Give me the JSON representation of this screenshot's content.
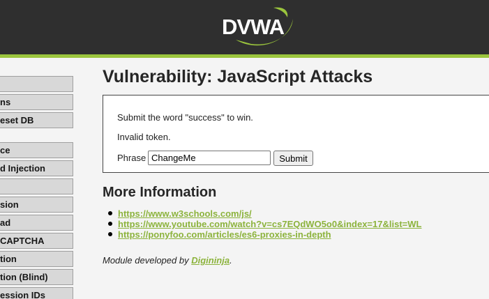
{
  "logo": {
    "text": "DVWA",
    "swoosh_color": "#9bc53d"
  },
  "colors": {
    "header_bg": "#2f2f2f",
    "accent": "#9bc53d",
    "link": "#8cb33c"
  },
  "sidebar": {
    "items": [
      {
        "label": ""
      },
      {
        "label": "ns"
      },
      {
        "label": "eset DB"
      },
      {
        "label": "ce"
      },
      {
        "label": "d Injection"
      },
      {
        "label": ""
      },
      {
        "label": "sion"
      },
      {
        "label": "ad"
      },
      {
        "label": "CAPTCHA"
      },
      {
        "label": "tion"
      },
      {
        "label": "tion (Blind)"
      },
      {
        "label": "ession IDs"
      }
    ]
  },
  "main": {
    "title": "Vulnerability: JavaScript Attacks",
    "box": {
      "instruction": "Submit the word \"success\" to win.",
      "status": "Invalid token.",
      "phrase_label": "Phrase",
      "phrase_value": "ChangeMe",
      "submit_label": "Submit"
    },
    "more_info": {
      "heading": "More Information",
      "links": [
        "https://www.w3schools.com/js/",
        "https://www.youtube.com/watch?v=cs7EQdWO5o0&index=17&list=WL",
        "https://ponyfoo.com/articles/es6-proxies-in-depth"
      ]
    },
    "credit": {
      "prefix": "Module developed by ",
      "author": "Digininja",
      "suffix": "."
    }
  }
}
